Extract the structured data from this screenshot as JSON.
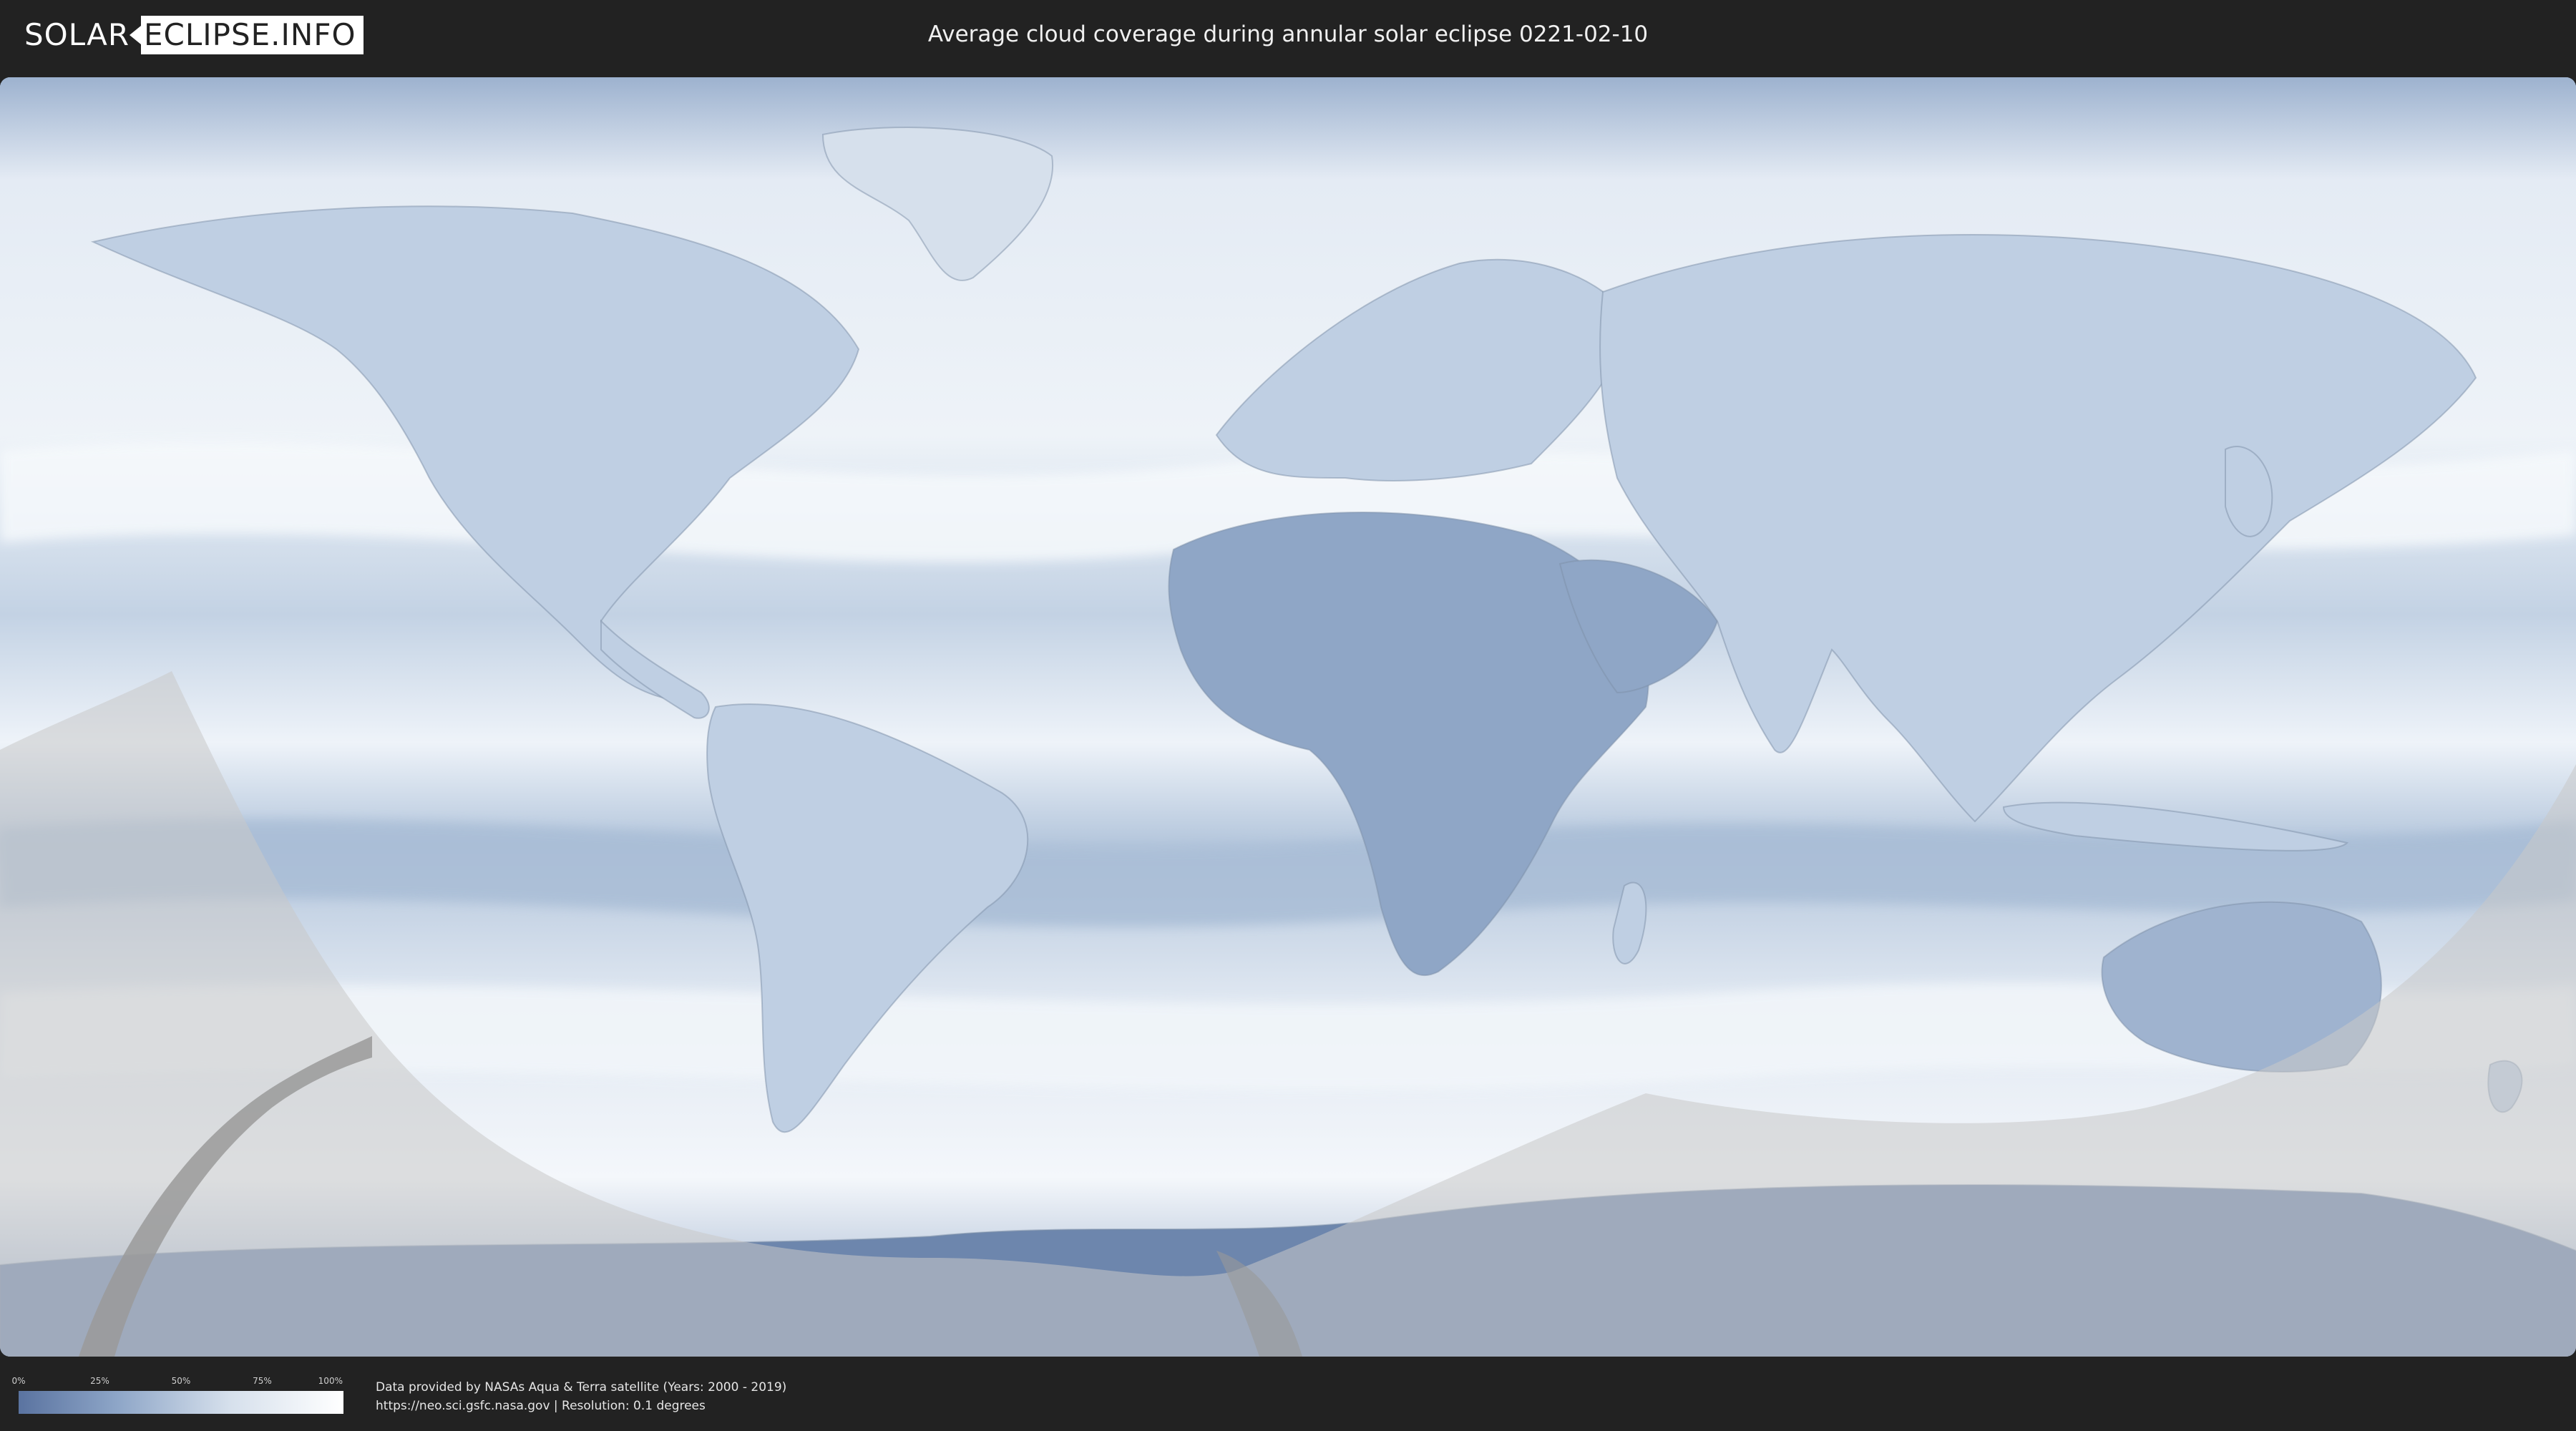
{
  "header": {
    "logo_left": "SOLAR",
    "logo_right": "ECLIPSE.INFO",
    "title": "Average cloud coverage during annular solar eclipse 0221-02-10"
  },
  "legend": {
    "ticks": [
      "0%",
      "25%",
      "50%",
      "75%",
      "100%"
    ],
    "low_color": "#5a73a0",
    "high_color": "#ffffff"
  },
  "credits": {
    "line1": "Data provided by NASAs Aqua & Terra satellite (Years: 2000 - 2019)",
    "line2": "https://neo.sci.gsfc.nasa.gov | Resolution: 0.1 degrees"
  },
  "colors": {
    "background": "#222222",
    "cloud_clear": "#5a73a0",
    "cloud_full": "#ffffff",
    "eclipse_overlay": "#c8c8c8"
  }
}
